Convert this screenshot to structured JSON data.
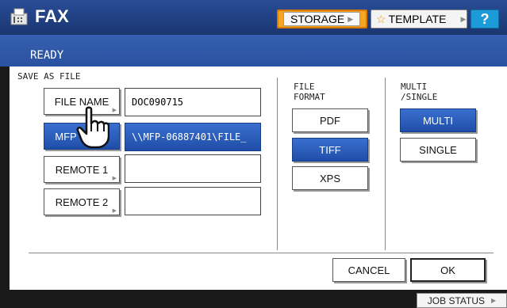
{
  "header": {
    "title": "FAX",
    "storage_label": "STORAGE",
    "template_label": "TEMPLATE",
    "help_label": "?"
  },
  "status": {
    "text": "READY"
  },
  "save_as_file": {
    "section_label": "SAVE AS FILE",
    "rows": [
      {
        "button": "FILE NAME",
        "value": "DOC090715"
      },
      {
        "button": "MFP",
        "value": "\\\\MFP-06887401\\FILE_"
      },
      {
        "button": "REMOTE 1",
        "value": ""
      },
      {
        "button": "REMOTE 2",
        "value": ""
      }
    ]
  },
  "file_format": {
    "label_line1": "FILE",
    "label_line2": "FORMAT",
    "options": [
      "PDF",
      "TIFF",
      "XPS"
    ],
    "selected": "TIFF"
  },
  "multi_single": {
    "label_line1": "MULTI",
    "label_line2": "/SINGLE",
    "options": [
      "MULTI",
      "SINGLE"
    ],
    "selected": "MULTI"
  },
  "actions": {
    "cancel_label": "CANCEL",
    "ok_label": "OK"
  },
  "footer": {
    "job_status_label": "JOB STATUS"
  },
  "colors": {
    "header_blue": "#1f3f80",
    "selected_blue": "#2a5cba",
    "storage_orange": "#f5a623",
    "help_blue": "#1d9bd8"
  }
}
